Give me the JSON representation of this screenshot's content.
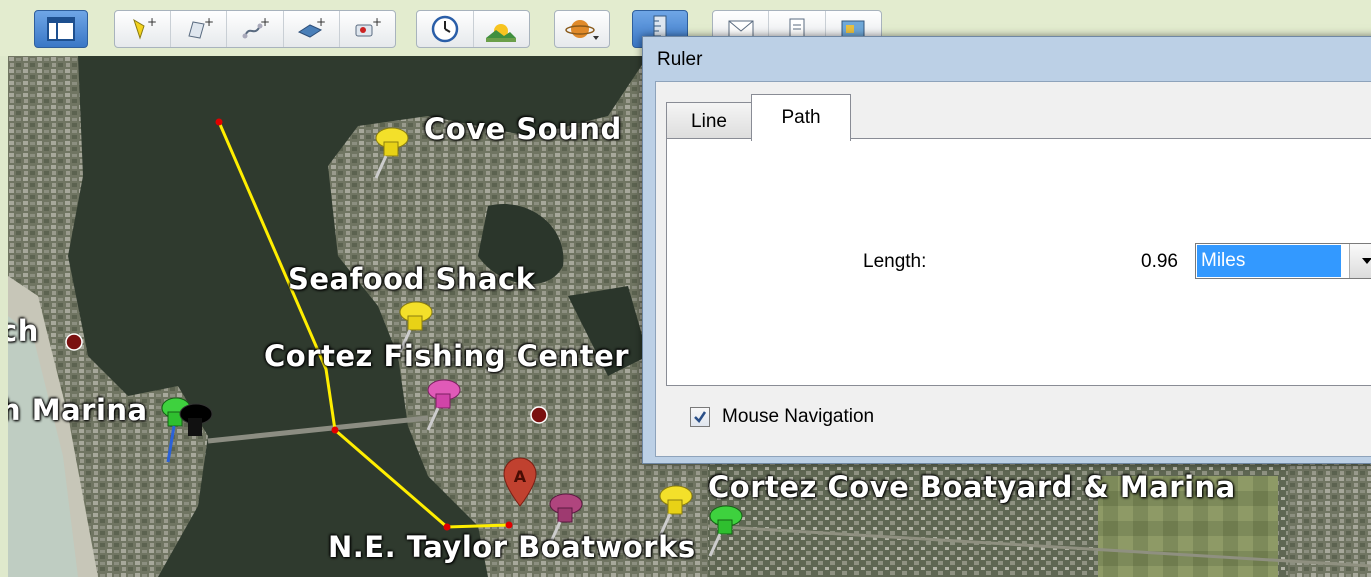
{
  "toolbar": {
    "buttons": [
      {
        "name": "sidebar-toggle-icon"
      },
      {
        "name": "add-placemark-icon"
      },
      {
        "name": "add-polygon-icon"
      },
      {
        "name": "add-path-icon"
      },
      {
        "name": "add-image-overlay-icon"
      },
      {
        "name": "record-tour-icon"
      },
      {
        "name": "historical-imagery-icon"
      },
      {
        "name": "sunlight-icon"
      },
      {
        "name": "planets-icon"
      },
      {
        "name": "ruler-icon"
      },
      {
        "name": "email-icon"
      },
      {
        "name": "print-icon"
      },
      {
        "name": "view-in-maps-icon"
      }
    ]
  },
  "map": {
    "labels": {
      "cove_sound": "Cove Sound",
      "seafood_shack": "Seafood Shack",
      "cortez_fishing": "Cortez Fishing Center",
      "marina_left": "h Marina",
      "ch_left": "ch",
      "cortez_cove": "Cortez Cove Boatyard & Marina",
      "taylor": "N.E. Taylor Boatworks"
    },
    "marker_letter": "A",
    "path_color": "#ffee00",
    "vertex_color": "#e00000"
  },
  "ruler": {
    "title": "Ruler",
    "tabs": [
      "Line",
      "Path"
    ],
    "active_tab": "Path",
    "length_label": "Length:",
    "length_value": "0.96",
    "units": "Miles",
    "mouse_navigation_label": "Mouse Navigation",
    "mouse_navigation_checked": true
  }
}
